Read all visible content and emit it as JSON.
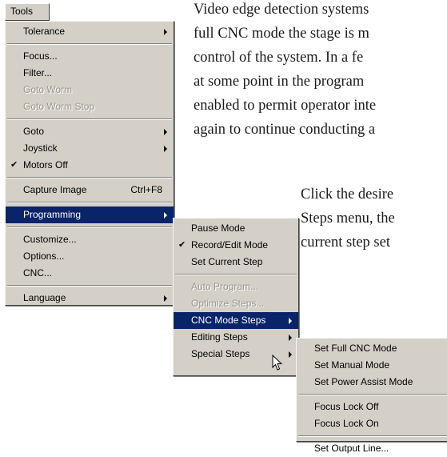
{
  "doc": {
    "para1": [
      "Video edge detection systems",
      "full CNC mode the stage is m",
      "control of the system.  In a fe",
      "at some point in the program",
      "enabled to permit operator inte",
      "again to continue conducting a"
    ],
    "para2": [
      "Click the desire",
      "Steps menu, the",
      "current step set"
    ]
  },
  "menubar": {
    "tools_label": "Tools"
  },
  "tools_menu": {
    "tolerance": "Tolerance",
    "focus": "Focus...",
    "filter": "Filter...",
    "goto_worm": "Goto Worm",
    "goto_worm_stop": "Goto Worm Stop",
    "goto": "Goto",
    "joystick": "Joystick",
    "motors_off": "Motors Off",
    "capture_image": "Capture Image",
    "capture_shortcut": "Ctrl+F8",
    "programming": "Programming",
    "customize": "Customize...",
    "options": "Options...",
    "cnc": "CNC...",
    "language": "Language"
  },
  "programming_menu": {
    "pause_mode": "Pause Mode",
    "record_edit_mode": "Record/Edit Mode",
    "set_current_step": "Set Current Step",
    "auto_program": "Auto Program...",
    "optimize_steps": "Optimize Steps...",
    "cnc_mode_steps": "CNC Mode Steps",
    "editing_steps": "Editing Steps",
    "special_steps": "Special Steps"
  },
  "cnc_menu": {
    "set_full_cnc_mode": "Set Full CNC Mode",
    "set_manual_mode": "Set Manual Mode",
    "set_power_assist_mode": "Set Power Assist Mode",
    "focus_lock_off": "Focus Lock Off",
    "focus_lock_on": "Focus Lock On",
    "set_output_line": "Set Output Line..."
  },
  "colors": {
    "menu_bg": "#d4d0c8",
    "highlight": "#0a246a",
    "disabled_text": "#9a978f"
  },
  "icons": {
    "check": "check-icon",
    "arrow": "submenu-arrow-icon",
    "cursor": "mouse-pointer-icon"
  }
}
